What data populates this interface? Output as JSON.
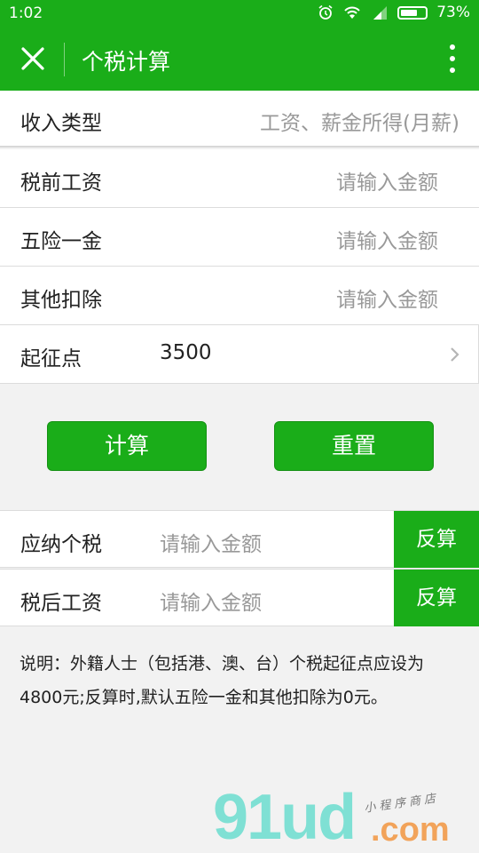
{
  "status": {
    "time": "1:02",
    "battery": "73%",
    "battery_level": 0.73
  },
  "header": {
    "title": "个税计算"
  },
  "income_type": {
    "label": "收入类型",
    "value": "工资、薪金所得(月薪)"
  },
  "fields": {
    "salary": {
      "label": "税前工资",
      "placeholder": "请输入金额"
    },
    "insurance": {
      "label": "五险一金",
      "placeholder": "请输入金额"
    },
    "other": {
      "label": "其他扣除",
      "placeholder": "请输入金额"
    }
  },
  "threshold": {
    "label": "起征点",
    "value": "3500"
  },
  "buttons": {
    "calc": "计算",
    "reset": "重置"
  },
  "results": {
    "tax": {
      "label": "应纳个税",
      "placeholder": "请输入金额",
      "reverse": "反算"
    },
    "net": {
      "label": "税后工资",
      "placeholder": "请输入金额",
      "reverse": "反算"
    }
  },
  "note": {
    "text": "说明：外籍人士（包括港、澳、台）个税起征点应设为4800元;反算时,默认五险一金和其他扣除为0元。"
  },
  "watermark": {
    "brand": "91ud",
    "domain": ".com",
    "tagline": "小程序商店"
  },
  "colors": {
    "primary": "#1aad19",
    "placeholder": "#999999"
  }
}
